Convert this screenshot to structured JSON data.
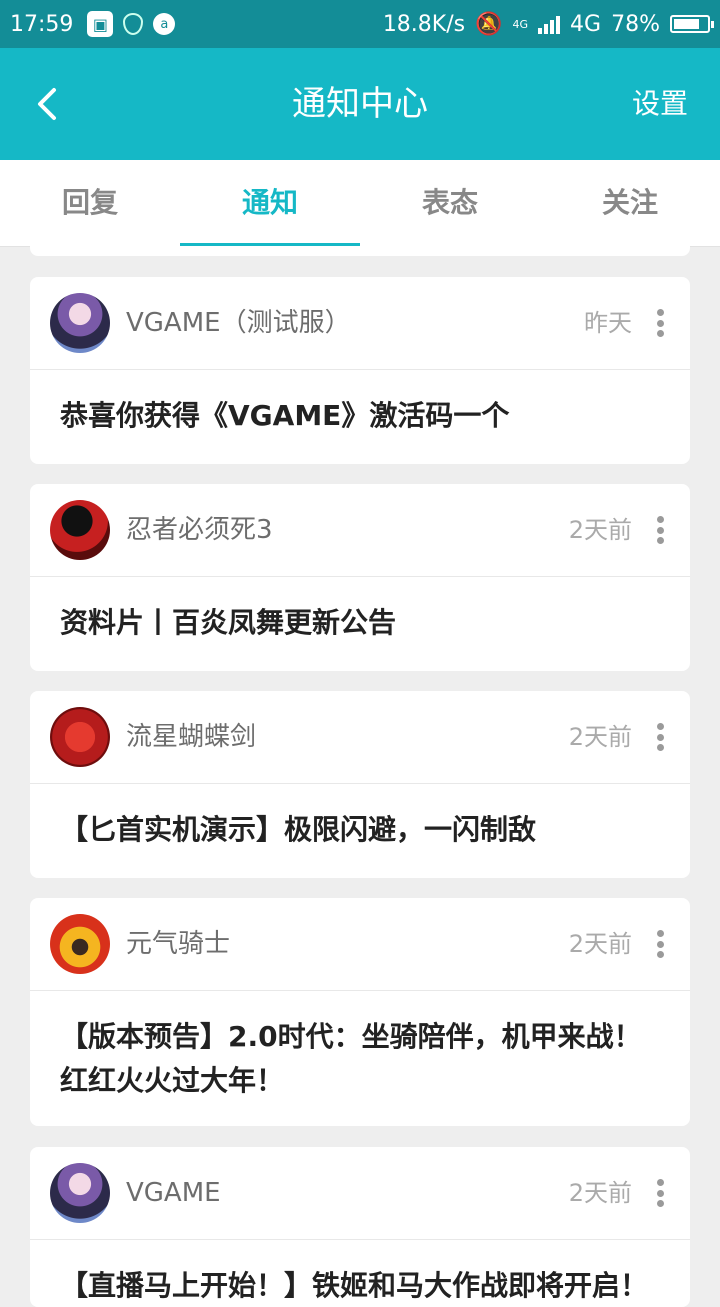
{
  "status_bar": {
    "time": "17:59",
    "net_speed": "18.8K/s",
    "network_small": "4G",
    "network": "4G",
    "battery": "78%",
    "battery_level": 0.78
  },
  "app_bar": {
    "title": "通知中心",
    "settings": "设置",
    "back_icon": "back-arrow"
  },
  "tabs": [
    {
      "label": "回复",
      "active": false
    },
    {
      "label": "通知",
      "active": true
    },
    {
      "label": "表态",
      "active": false
    },
    {
      "label": "关注",
      "active": false
    }
  ],
  "notifications": [
    {
      "sender": "VGAME（测试服）",
      "time": "昨天",
      "content": "恭喜你获得《VGAME》激活码一个"
    },
    {
      "sender": "忍者必须死3",
      "time": "2天前",
      "content": "资料片丨百炎凤舞更新公告"
    },
    {
      "sender": "流星蝴蝶剑",
      "time": "2天前",
      "content": "【匕首实机演示】极限闪避，一闪制敌"
    },
    {
      "sender": "元气骑士",
      "time": "2天前",
      "content": "【版本预告】2.0时代：坐骑陪伴，机甲来战！红红火火过大年！"
    },
    {
      "sender": "VGAME",
      "time": "2天前",
      "content": "【直播马上开始！】铁姬和马大作战即将开启！"
    }
  ],
  "colors": {
    "status_bar": "#138d97",
    "accent": "#15b8c6",
    "background": "#eeeeee"
  }
}
